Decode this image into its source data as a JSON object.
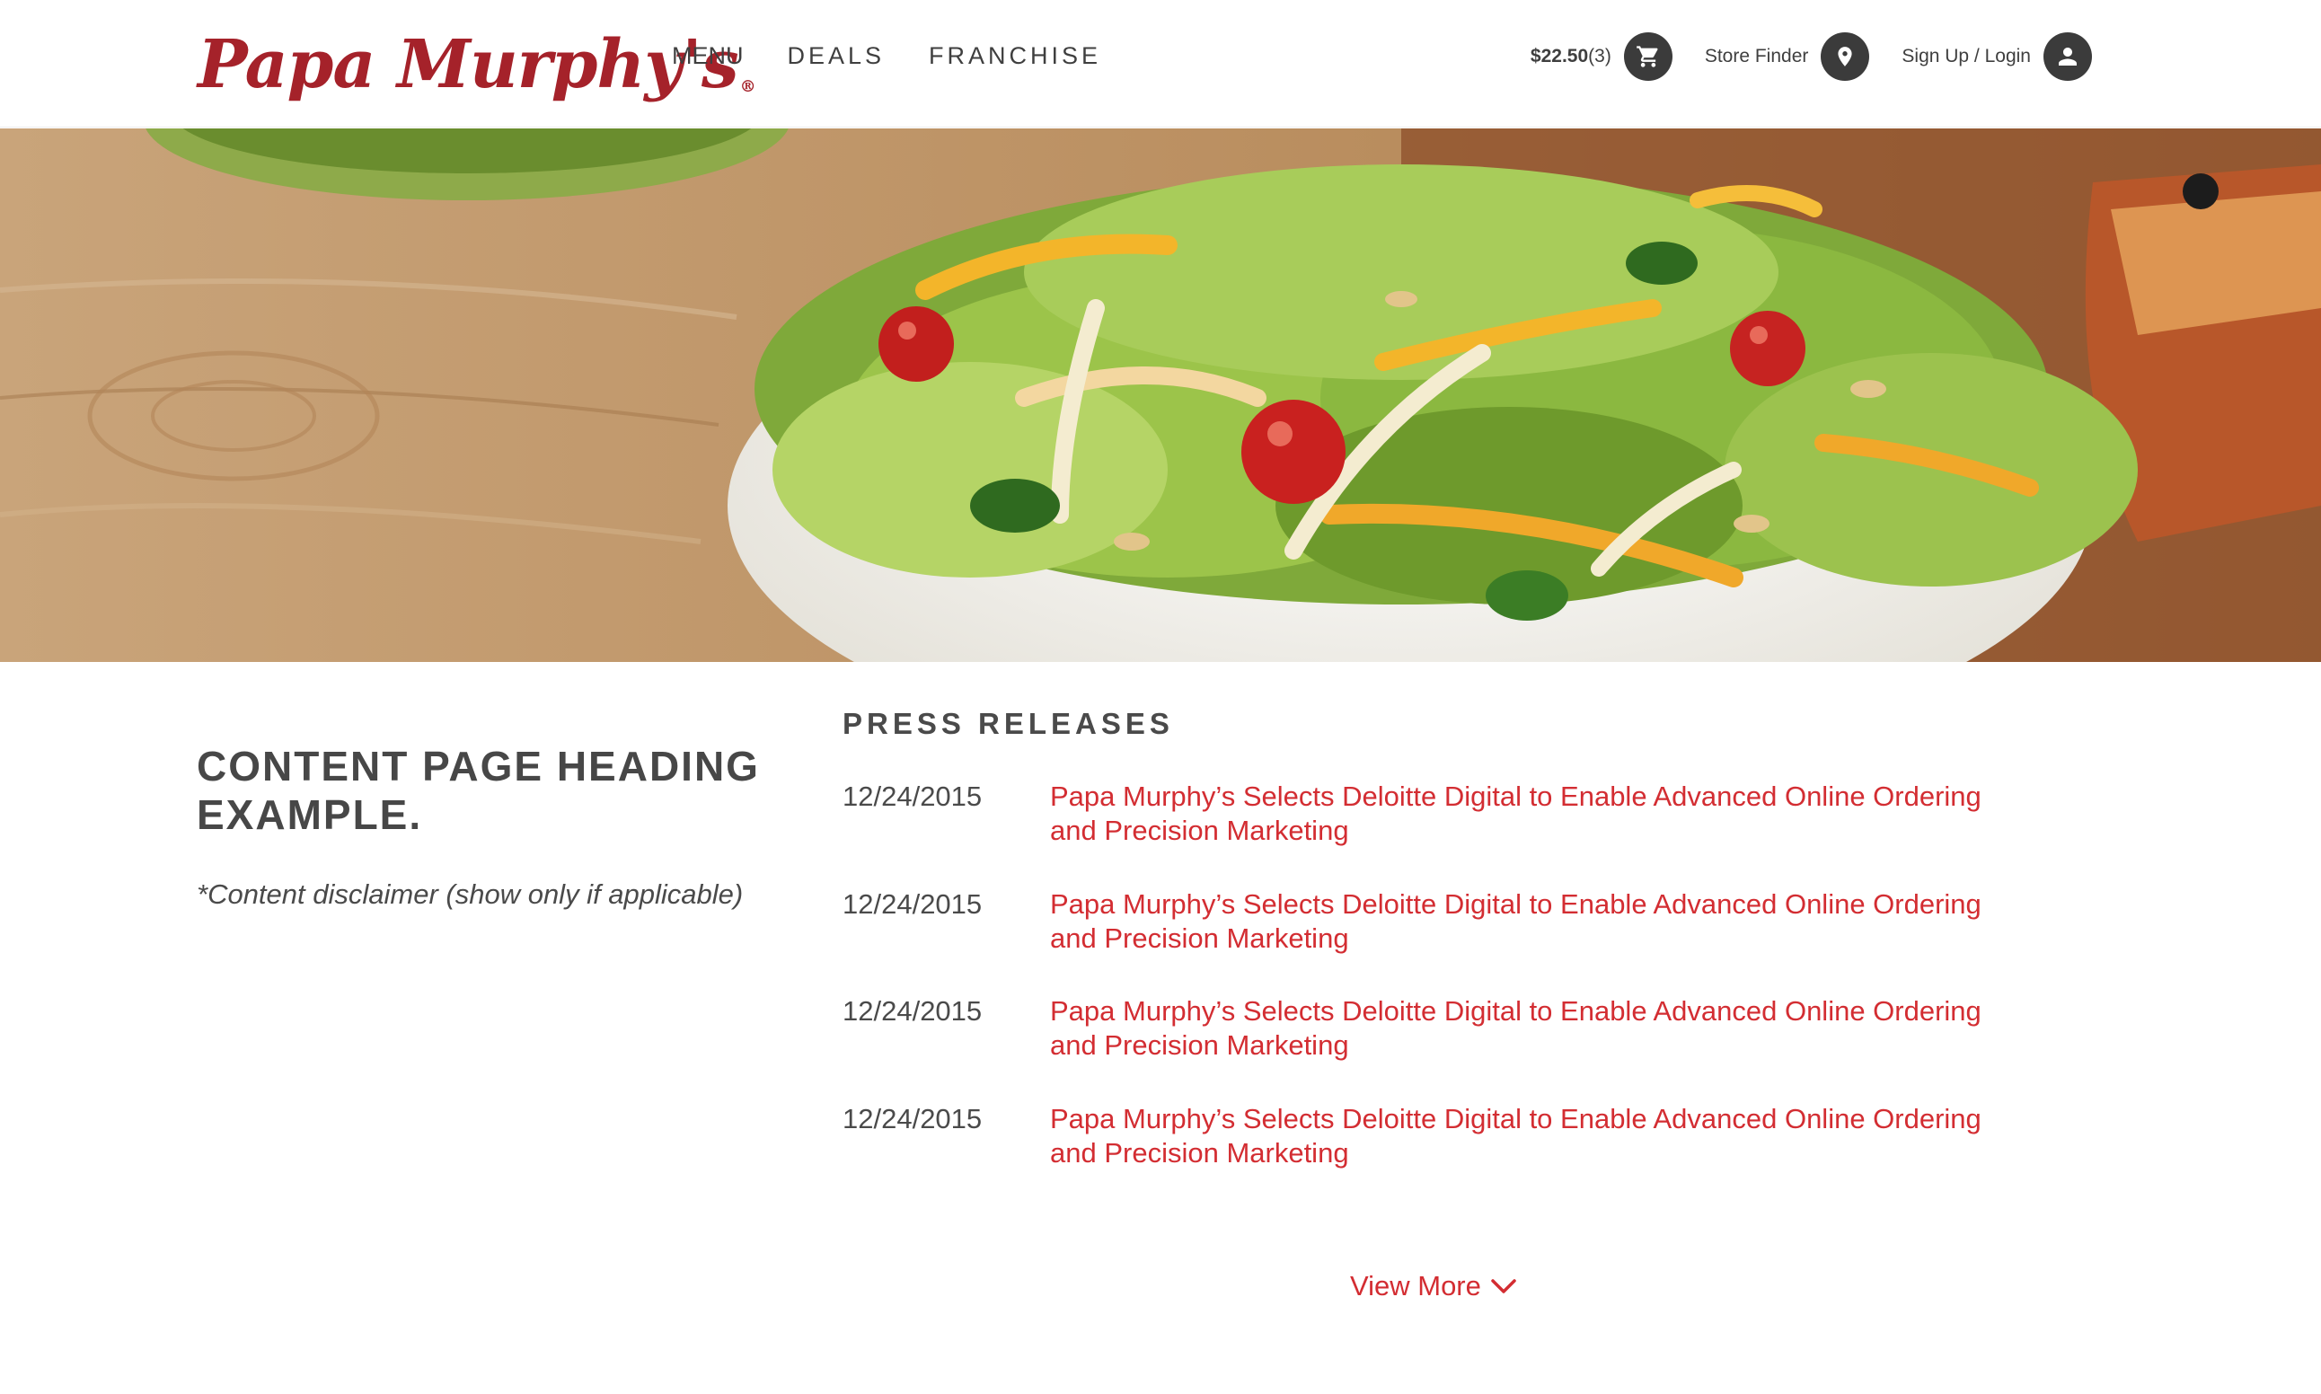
{
  "header": {
    "logo_text": "Papa Murphy's",
    "logo_reg": "®",
    "nav": [
      {
        "label": "MENU"
      },
      {
        "label": "DEALS"
      },
      {
        "label": "FRANCHISE"
      }
    ],
    "cart": {
      "total": "$22.50",
      "count": "(3)",
      "icon": "cart-icon"
    },
    "store_finder": {
      "label": "Store Finder",
      "icon": "location-pin-icon"
    },
    "account": {
      "label": "Sign Up / Login",
      "icon": "user-icon"
    }
  },
  "hero": {
    "image": "salad-bowl-photo"
  },
  "main": {
    "heading": "CONTENT PAGE HEADING EXAMPLE.",
    "disclaimer": "*Content disclaimer (show only if applicable)"
  },
  "press": {
    "title": "PRESS RELEASES",
    "items": [
      {
        "date": "12/24/2015",
        "title": "Papa Murphy’s Selects Deloitte Digital to Enable Advanced Online Ordering and Precision Marketing"
      },
      {
        "date": "12/24/2015",
        "title": "Papa Murphy’s Selects Deloitte Digital to Enable Advanced Online Ordering and Precision Marketing"
      },
      {
        "date": "12/24/2015",
        "title": "Papa Murphy’s Selects Deloitte Digital to Enable Advanced Online Ordering and Precision Marketing"
      },
      {
        "date": "12/24/2015",
        "title": "Papa Murphy’s Selects Deloitte Digital to Enable Advanced Online Ordering and Precision Marketing"
      }
    ],
    "view_more": "View More",
    "view_more_icon": "chevron-down-icon"
  },
  "colors": {
    "brand_red": "#a5222a",
    "link_red": "#d32d32",
    "icon_dark": "#3b3b3b",
    "text": "#4a4a4a"
  }
}
